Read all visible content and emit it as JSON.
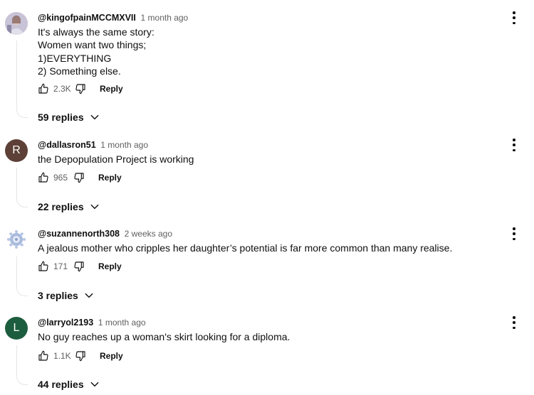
{
  "comments": [
    {
      "author": "@kingofpainMCCMXVII",
      "time": "1 month ago",
      "lines": [
        "It's always the same story:",
        "Women want two things;",
        "1)EVERYTHING",
        "2) Something else."
      ],
      "likes": "2.3K",
      "reply_label": "Reply",
      "replies_label": "59 replies",
      "avatar_letter": "",
      "avatar_color": "#b8b4c4"
    },
    {
      "author": "@dallasron51",
      "time": "1 month ago",
      "lines": [
        "the Depopulation Project is working"
      ],
      "likes": "965",
      "reply_label": "Reply",
      "replies_label": "22 replies",
      "avatar_letter": "R",
      "avatar_color": "#5d4037"
    },
    {
      "author": "@suzannenorth308",
      "time": "2 weeks ago",
      "lines": [
        "A jealous mother who cripples her daughter’s potential is far more common than many realise."
      ],
      "likes": "171",
      "reply_label": "Reply",
      "replies_label": "3 replies",
      "avatar_letter": "",
      "avatar_color": "#9fb2d6"
    },
    {
      "author": "@larryol2193",
      "time": "1 month ago",
      "lines": [
        "No guy reaches up a woman's skirt looking for a diploma."
      ],
      "likes": "1.1K",
      "reply_label": "Reply",
      "replies_label": "44 replies",
      "avatar_letter": "L",
      "avatar_color": "#1d5d3f"
    }
  ]
}
